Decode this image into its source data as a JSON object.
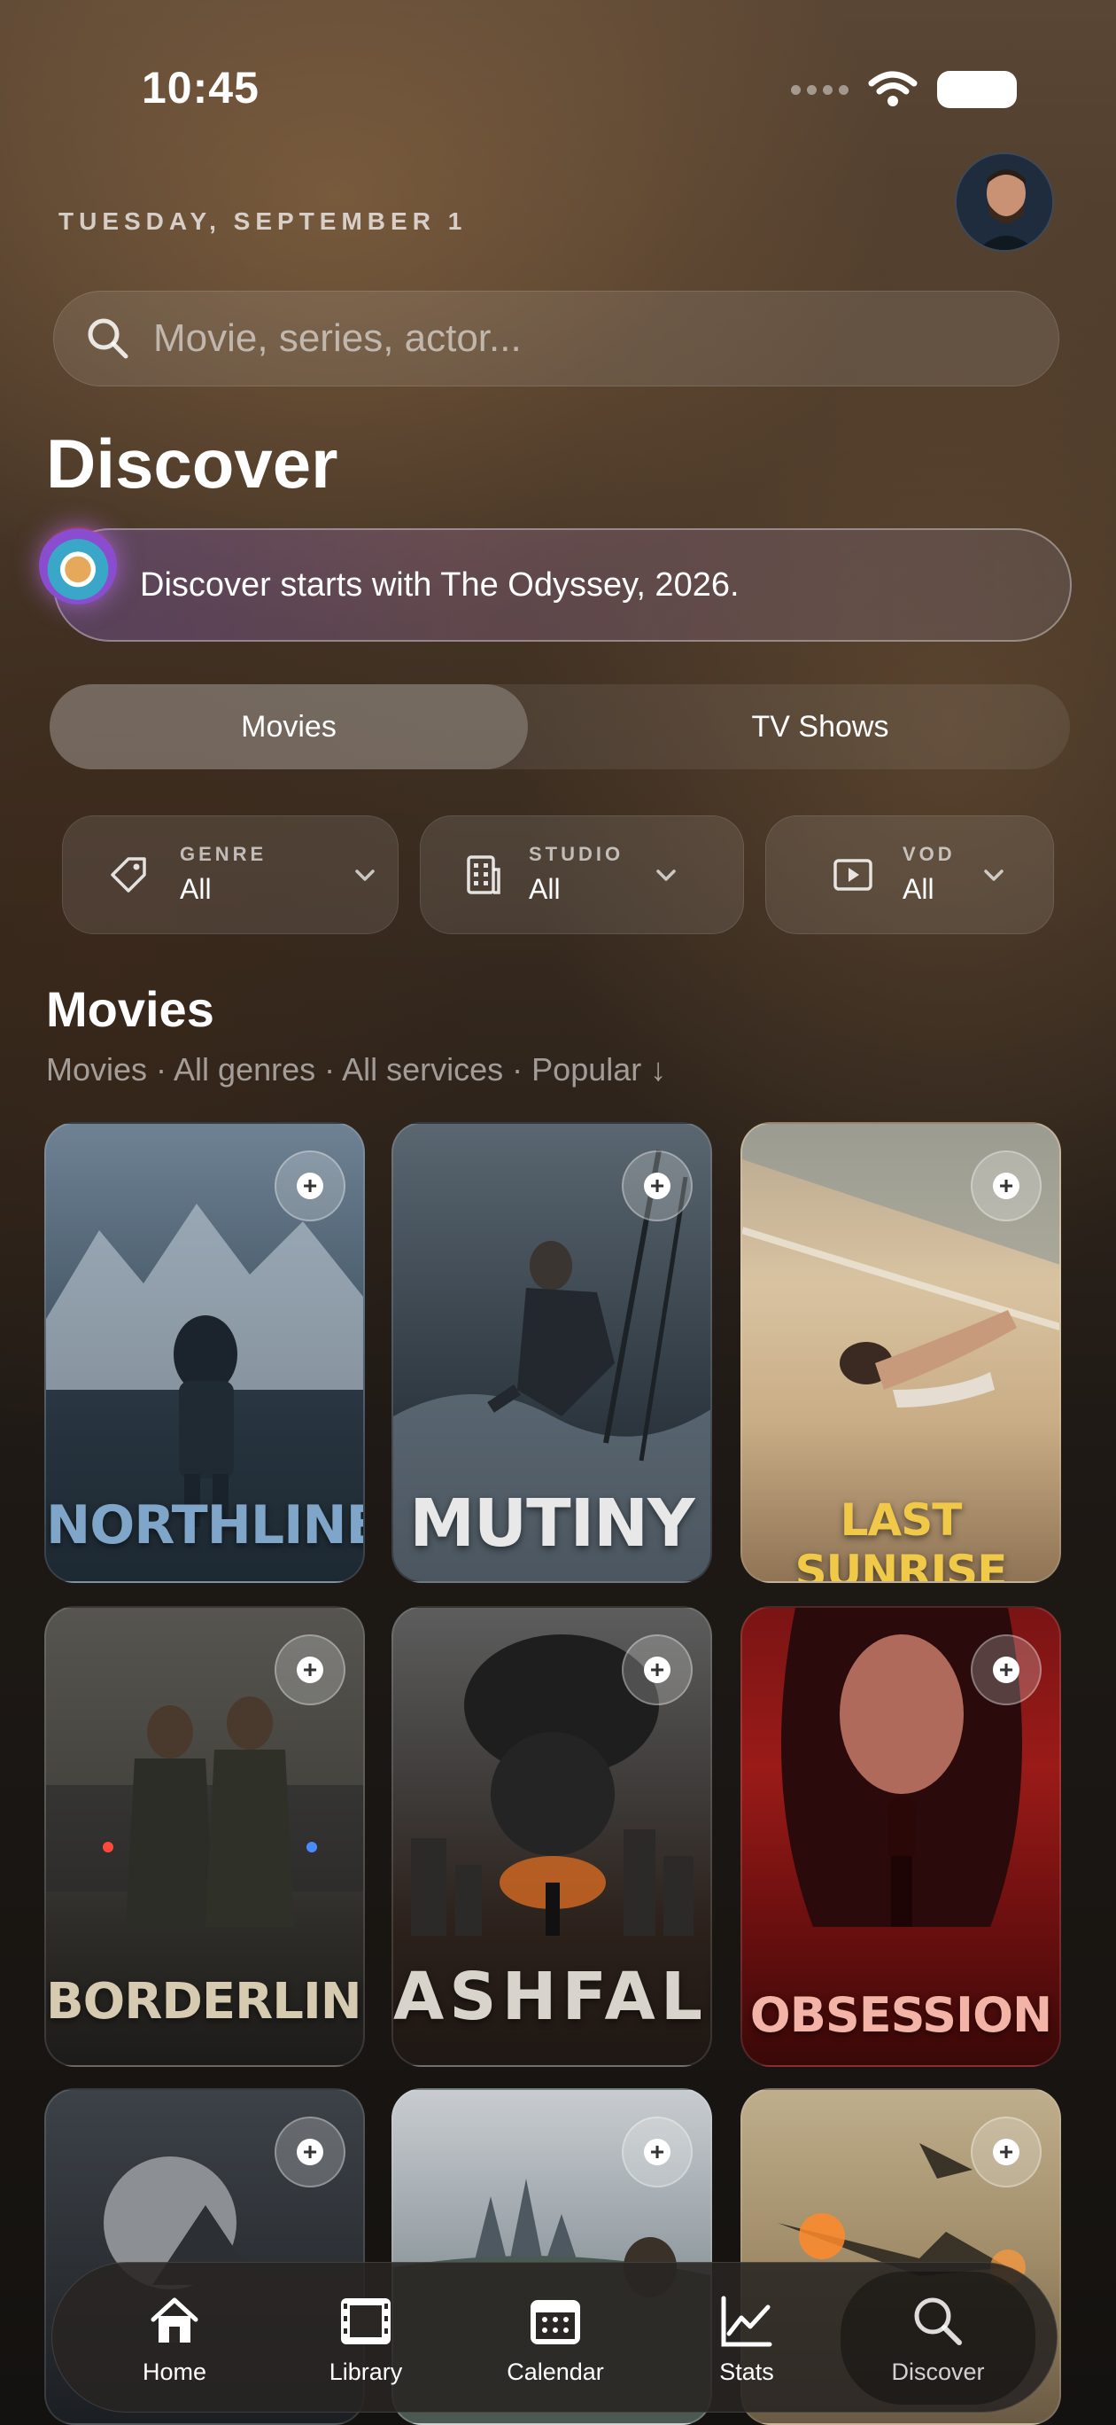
{
  "status_bar": {
    "time": "10:45"
  },
  "header": {
    "date": "TUESDAY, SEPTEMBER 1"
  },
  "search": {
    "placeholder": "Movie, series, actor..."
  },
  "page": {
    "title": "Discover"
  },
  "banner": {
    "text": "Discover starts with The Odyssey, 2026."
  },
  "segments": {
    "movies": "Movies",
    "tv_shows": "TV Shows",
    "selected": "Movies"
  },
  "filters": [
    {
      "label": "GENRE",
      "value": "All",
      "icon": "tag-icon"
    },
    {
      "label": "STUDIO",
      "value": "All",
      "icon": "building-icon"
    },
    {
      "label": "VOD",
      "value": "All",
      "icon": "play-square-icon"
    }
  ],
  "section": {
    "title": "Movies",
    "subtitle": "Movies · All genres · All services · Popular ↓"
  },
  "posters": [
    {
      "title": "NORTHLINE",
      "title_color": "#7fa6c8"
    },
    {
      "title": "MUTINY",
      "title_color": "#e8e8e8"
    },
    {
      "title": "LAST SUNRISE",
      "title_color": "#f0c948"
    },
    {
      "title": "BORDERLINE",
      "title_color": "#d6cbb0"
    },
    {
      "title": "ASHFALL",
      "title_color": "#d8d4cc"
    },
    {
      "title": "OBSESSION",
      "title_color": "#f3b3a6"
    },
    {
      "title": "",
      "title_color": "#ffffff"
    },
    {
      "title": "",
      "title_color": "#ffffff"
    },
    {
      "title": "",
      "title_color": "#ffffff"
    }
  ],
  "tabbar": [
    {
      "label": "Home",
      "icon": "home-icon"
    },
    {
      "label": "Library",
      "icon": "film-icon"
    },
    {
      "label": "Calendar",
      "icon": "calendar-icon"
    },
    {
      "label": "Stats",
      "icon": "chart-icon"
    },
    {
      "label": "Discover",
      "icon": "search-icon",
      "active": true
    }
  ]
}
